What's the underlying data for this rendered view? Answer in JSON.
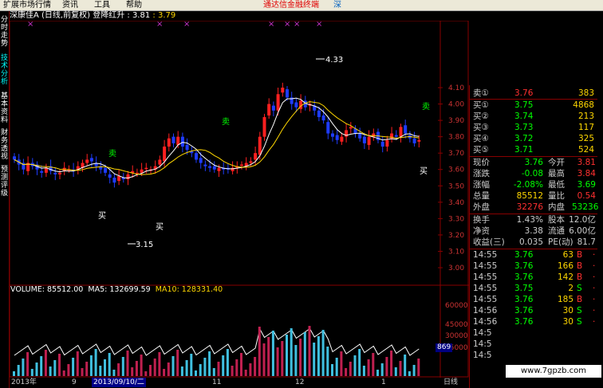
{
  "menu": {
    "items": [
      "扩展市场行情",
      "资讯",
      "工具",
      "帮助"
    ],
    "promo": "通达信金融终端",
    "promo_tail": "深"
  },
  "side_tabs": [
    "分时走势",
    "技术分析",
    "基本资料",
    "财务透视",
    "预测评级"
  ],
  "title": {
    "name": "深康佳A",
    "mode": "(日线,前复权)",
    "indicator": "登降红升",
    "v1": ": 3.81",
    "v2": ": 3.79"
  },
  "price_axis": {
    "labels": [
      "4.10",
      "4.00",
      "3.90",
      "3.80",
      "3.70",
      "3.60",
      "3.50",
      "3.40",
      "3.30",
      "3.20",
      "3.10",
      "3.00"
    ],
    "min": 3.0,
    "max": 4.1
  },
  "annotations": {
    "high": "4.33",
    "low": "3.15",
    "buy": "买",
    "sell": "卖"
  },
  "volume": {
    "label": "VOLUME: 85512.00",
    "ma5": "MA5: 132699.59",
    "ma10": "MA10: 128331.40",
    "axis": [
      "60000",
      "45000",
      "30000",
      "15000"
    ]
  },
  "bottom": {
    "year": "2013年",
    "m1": "9",
    "date": "2013/09/10/二",
    "m2": "11",
    "m3": "12",
    "m4": "1",
    "daily": "日线"
  },
  "tick_box": "869",
  "quote": {
    "sell": [
      {
        "label": "卖①",
        "price": "3.76",
        "vol": "383"
      }
    ],
    "buy": [
      {
        "label": "买①",
        "price": "3.75",
        "vol": "4868"
      },
      {
        "label": "买②",
        "price": "3.74",
        "vol": "213"
      },
      {
        "label": "买③",
        "price": "3.73",
        "vol": "117"
      },
      {
        "label": "买④",
        "price": "3.72",
        "vol": "325"
      },
      {
        "label": "买⑤",
        "price": "3.71",
        "vol": "524"
      }
    ],
    "stats": [
      {
        "l1": "现价",
        "v1": "3.76",
        "l2": "今开",
        "v2": "3.81"
      },
      {
        "l1": "涨跌",
        "v1": "-0.08",
        "l2": "最高",
        "v2": "3.84"
      },
      {
        "l1": "涨幅",
        "v1": "-2.08%",
        "l2": "最低",
        "v2": "3.69"
      },
      {
        "l1": "总量",
        "v1": "85512",
        "l2": "量比",
        "v2": "0.54"
      },
      {
        "l1": "外盘",
        "v1": "32276",
        "l2": "内盘",
        "v2": "53236"
      }
    ],
    "fund": [
      {
        "l1": "换手",
        "v1": "1.43%",
        "l2": "股本",
        "v2": "12.0亿"
      },
      {
        "l1": "净资",
        "v1": "3.38",
        "l2": "流通",
        "v2": "6.00亿"
      },
      {
        "l1": "收益(三)",
        "v1": "0.035",
        "l2": "PE(动)",
        "v2": "81.7"
      }
    ],
    "ticks": [
      {
        "time": "14:55",
        "price": "3.76",
        "vol": "63",
        "dir": "B"
      },
      {
        "time": "14:55",
        "price": "3.76",
        "vol": "166",
        "dir": "B"
      },
      {
        "time": "14:55",
        "price": "3.76",
        "vol": "142",
        "dir": "B"
      },
      {
        "time": "14:55",
        "price": "3.75",
        "vol": "2",
        "dir": "S"
      },
      {
        "time": "14:55",
        "price": "3.76",
        "vol": "185",
        "dir": "B"
      },
      {
        "time": "14:56",
        "price": "3.76",
        "vol": "30",
        "dir": "S"
      },
      {
        "time": "14:56",
        "price": "3.76",
        "vol": "30",
        "dir": "S"
      }
    ],
    "extra_times": [
      "14:5",
      "14:5",
      "14:5"
    ]
  },
  "watermark": "www.7gpzb.com",
  "colors": {
    "up": "#ff0000",
    "down": "#0000ff",
    "ma_white": "#ffffff",
    "ma_yellow": "#ffd700",
    "frame": "#880000",
    "sell_green": "#00ff00"
  }
}
